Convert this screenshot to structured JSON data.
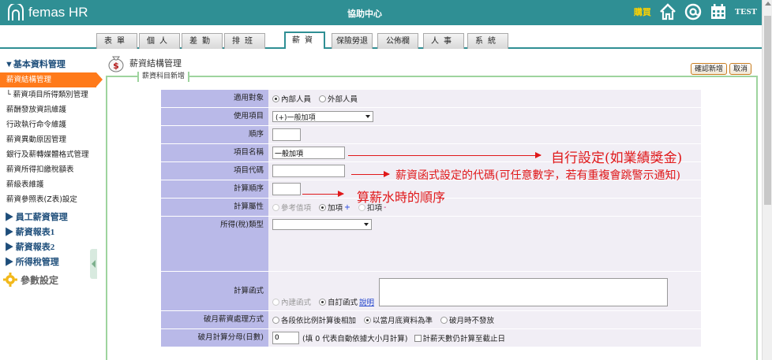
{
  "header": {
    "logo_text": "femas HR",
    "title": "協助中心",
    "buy_label": "購買",
    "user": "TEST",
    "icons": [
      "home-icon",
      "at-icon",
      "calendar-icon"
    ]
  },
  "tabs": [
    {
      "label": "表單"
    },
    {
      "label": "個人"
    },
    {
      "label": "差勤"
    },
    {
      "label": "排班"
    },
    {
      "label": "薪資"
    },
    {
      "label": "保險勞退"
    },
    {
      "label": "公佈欄"
    },
    {
      "label": "人事"
    },
    {
      "label": "系統"
    }
  ],
  "sidebar": {
    "section_title": "▼基本資料管理",
    "items": [
      {
        "label": "薪資結構管理"
      },
      {
        "label": "└ 薪資項目所得類別管理"
      },
      {
        "label": "薪酬發放資訊維護"
      },
      {
        "label": "行政執行命令維護"
      },
      {
        "label": "薪資異動原因管理"
      },
      {
        "label": "銀行及薪轉媒體格式管理"
      },
      {
        "label": "薪資所得扣繳稅額表"
      },
      {
        "label": "薪級表維護"
      },
      {
        "label": "薪資參照表(Z表)設定"
      }
    ],
    "groups": [
      {
        "label": "▶ 員工薪資管理"
      },
      {
        "label": "▶ 薪資報表1"
      },
      {
        "label": "▶ 薪資報表2"
      },
      {
        "label": "▶ 所得稅管理"
      }
    ],
    "settings_label": "參數設定"
  },
  "main": {
    "page_title": "薪資結構管理",
    "confirm_button": "確認新增",
    "cancel_button": "取消",
    "panel_legend": "薪資科目新增"
  },
  "form": {
    "applies_to_label": "適用對象",
    "applies_to_options": [
      "內部人員",
      "外部人員"
    ],
    "usage_label": "使用項目",
    "usage_value": "(+)一般加項",
    "order_label": "順序",
    "order_value": "",
    "name_label": "項目名稱",
    "name_value": "一般加項",
    "code_label": "項目代碼",
    "code_value": "",
    "calc_order_label": "計算順序",
    "calc_order_value": "",
    "calc_attr_label": "計算屬性",
    "calc_attr_options": [
      "參考值項",
      "加項",
      "扣項"
    ],
    "plus_sign": "+",
    "minus_sign": "-",
    "tax_type_label": "所得(稅)類型",
    "tax_type_value": "",
    "calc_func_label": "計算函式",
    "calc_func_options": [
      "內建函式",
      "自訂函式"
    ],
    "calc_func_link": "說明",
    "partial_month_label": "破月薪資處理方式",
    "partial_month_options": [
      "各段依比例計算後相加",
      "以當月底資料為準",
      "破月時不發放"
    ],
    "partial_days_label": "破月計算分母(日數)",
    "partial_days_value": "0",
    "partial_days_hint": "(填 0 代表自動依據大小月計算)",
    "partial_days_checkbox": "計薪天數仍計算至截止日"
  },
  "annotations": {
    "name_note": "自行設定(如業績獎金)",
    "code_note": "薪資函式設定的代碼(可任意數字，若有重複會跳警示通知)",
    "order_note": "算薪水時的順序"
  },
  "colors": {
    "header_bg": "#2f8f94",
    "sidebar_active": "#ff7a1a",
    "label_bg": "#b9b9e8",
    "annotation_red": "#e0181a"
  }
}
